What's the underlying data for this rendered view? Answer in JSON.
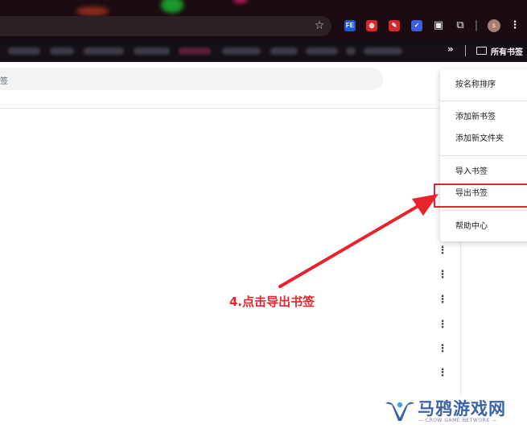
{
  "bookmarks_bar": {
    "overflow_label": "»",
    "all_bookmarks_label": "所有书签"
  },
  "extensions": [
    {
      "name": "fe-extension-icon",
      "label": "FE",
      "color": "#2457d6"
    },
    {
      "name": "red-extension-icon",
      "label": "◍",
      "color": "#d8282e"
    },
    {
      "name": "pen-extension-icon",
      "label": "✎",
      "color": "#d8282e"
    },
    {
      "name": "shield-extension-icon",
      "label": "✓",
      "color": "#3b5fe0"
    }
  ],
  "toolbar": {
    "avatar_letter": "s"
  },
  "search": {
    "partial_text": "签"
  },
  "menu": {
    "items": [
      {
        "label": "按名称排序"
      },
      {
        "label": "添加新书签"
      },
      {
        "label": "添加新文件夹"
      },
      {
        "label": "导入书签"
      },
      {
        "label": "导出书签",
        "highlighted": true
      },
      {
        "label": "帮助中心"
      }
    ]
  },
  "annotation": {
    "text": "4.点击导出书签",
    "color": "#e8232c"
  },
  "watermark": {
    "title": "马鸦游戏网",
    "subtitle": "— CROW GAME NETWORK —"
  }
}
